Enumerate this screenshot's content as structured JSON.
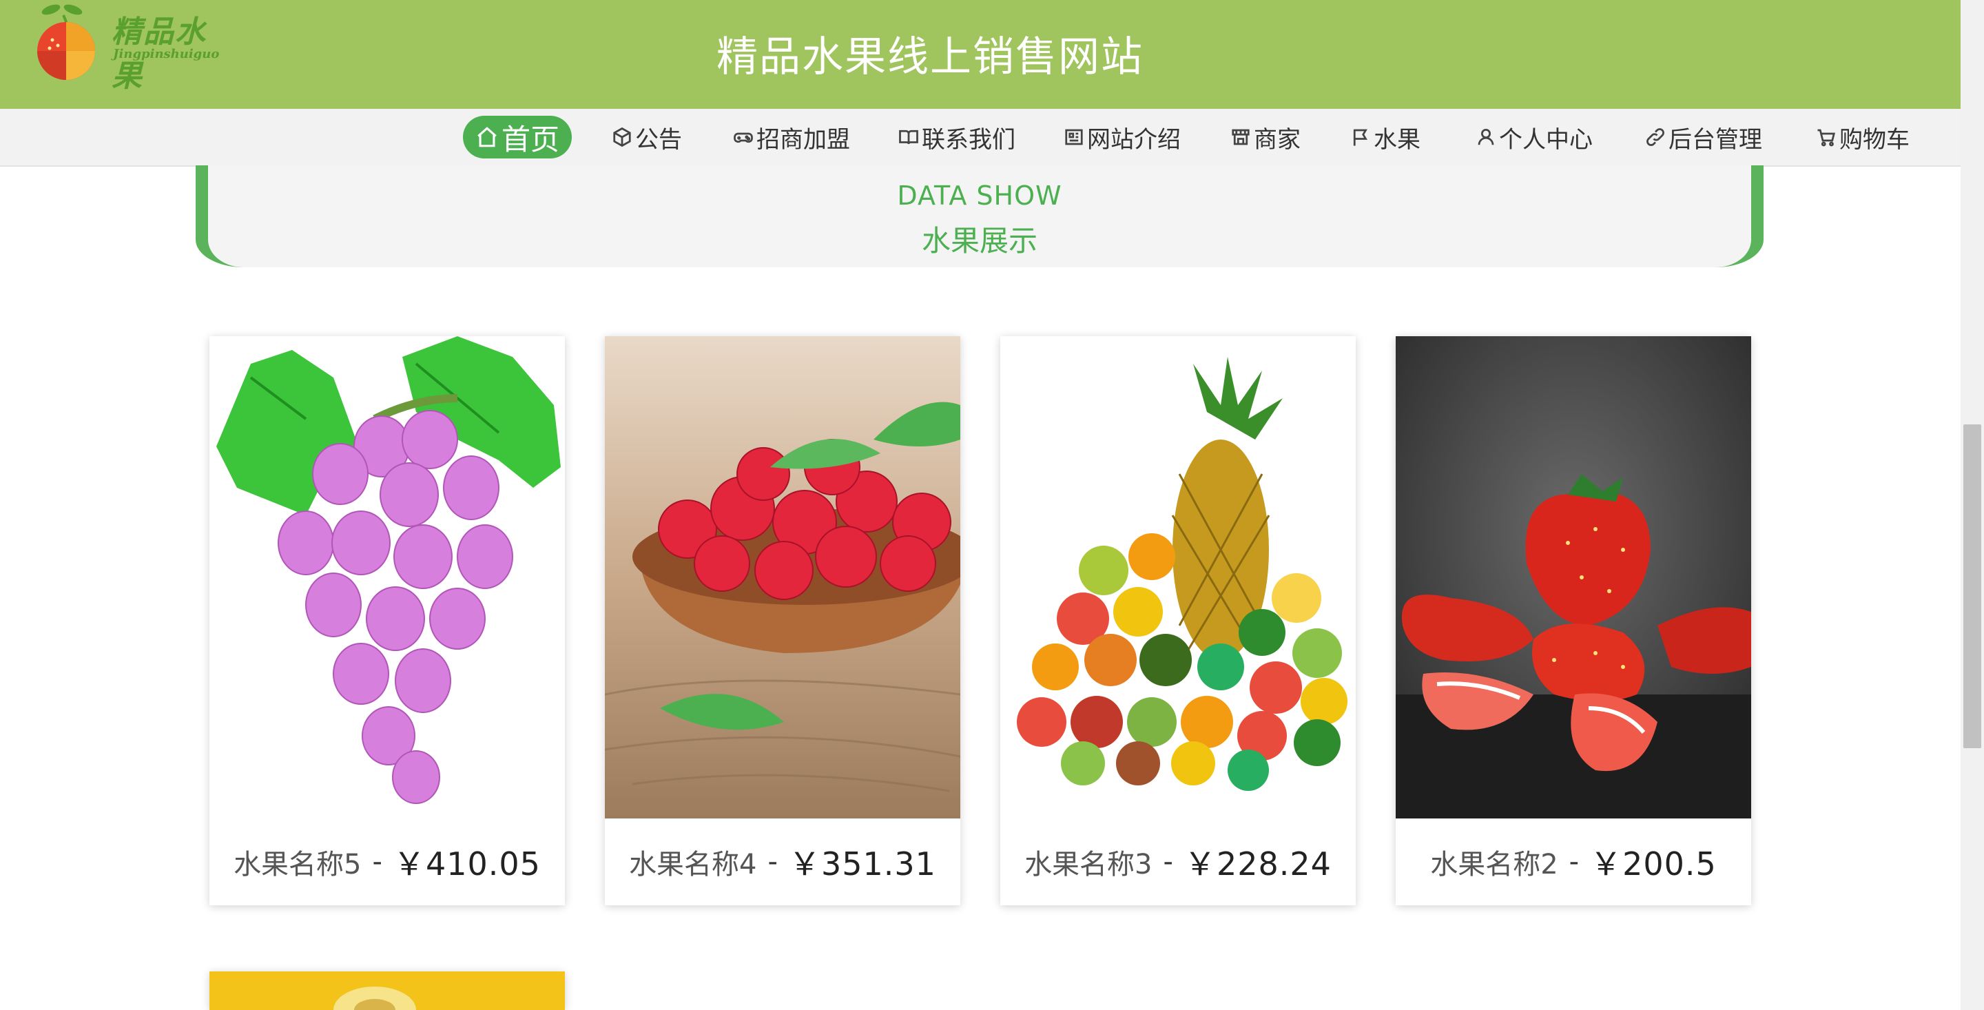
{
  "header": {
    "logo_text": "精品水果",
    "logo_sub": "Jingpinshuiguo",
    "title": "精品水果线上销售网站"
  },
  "nav": {
    "items": [
      {
        "label": "首页",
        "icon": "home-icon",
        "active": true
      },
      {
        "label": "公告",
        "icon": "box-icon"
      },
      {
        "label": "招商加盟",
        "icon": "gamepad-icon"
      },
      {
        "label": "联系我们",
        "icon": "book-icon"
      },
      {
        "label": "网站介绍",
        "icon": "newspaper-icon"
      },
      {
        "label": "商家",
        "icon": "store-icon"
      },
      {
        "label": "水果",
        "icon": "flag-icon"
      },
      {
        "label": "个人中心",
        "icon": "user-icon"
      },
      {
        "label": "后台管理",
        "icon": "link-icon"
      },
      {
        "label": "购物车",
        "icon": "cart-icon"
      }
    ]
  },
  "section": {
    "title_en": "DATA SHOW",
    "title_cn": "水果展示"
  },
  "products": [
    {
      "name": "水果名称5",
      "sep": "-",
      "price": "￥410.05",
      "image": "grapes"
    },
    {
      "name": "水果名称4",
      "sep": "-",
      "price": "￥351.31",
      "image": "raspberries"
    },
    {
      "name": "水果名称3",
      "sep": "-",
      "price": "￥228.24",
      "image": "mixed-fruit"
    },
    {
      "name": "水果名称2",
      "sep": "-",
      "price": "￥200.5",
      "image": "strawberries"
    }
  ],
  "colors": {
    "header_bg": "#a0c45e",
    "accent": "#4caf50"
  }
}
